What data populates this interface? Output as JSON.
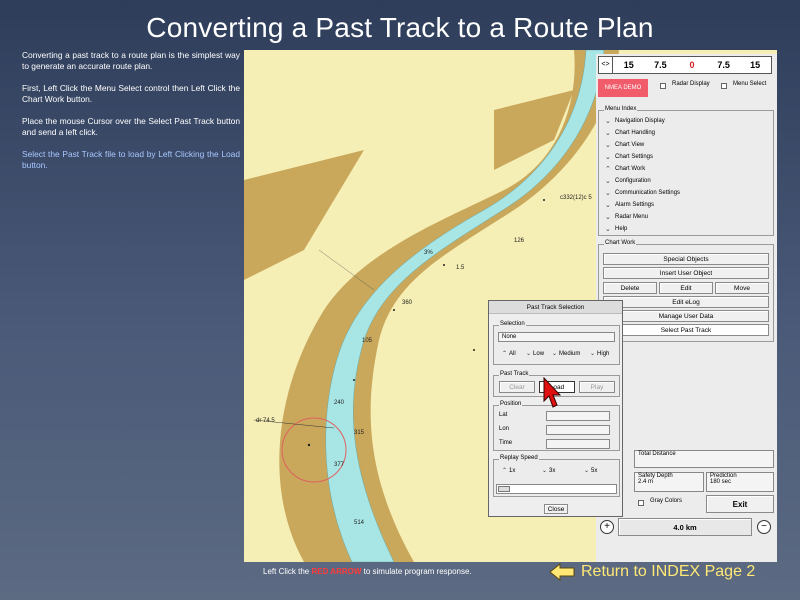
{
  "slide": {
    "title": "Converting a Past Track to a Route Plan",
    "para1": "Converting a past track to a route plan is the simplest way to generate an accurate route plan.",
    "para2": "First, Left Click the Menu Select control then Left Click the Chart Work button.",
    "para3": "Place the mouse Cursor over the Select Past Track button and send a left click.",
    "para4": "Select the Past Track file to load by Left Clicking the Load button.",
    "footer_prefix": "Left Click the ",
    "footer_red": "RED ARROW",
    "footer_suffix": " to simulate program response.",
    "return_link": "Return to INDEX Page 2"
  },
  "chart": {
    "depth_labels": [
      "c332(12)c 5",
      "3%",
      "126",
      "1.5",
      "360",
      "105",
      "240",
      "315",
      "377",
      "514",
      "dr 74.5"
    ]
  },
  "panel": {
    "scale": {
      "arrows": "<>",
      "ticks": [
        "15",
        "7.5",
        "0",
        "7.5",
        "15"
      ]
    },
    "nmea_demo": "NMEA DEMO",
    "radar_display": "Radar Display",
    "menu_select": "Menu Select",
    "menu_index_title": "Menu Index",
    "menu_items": [
      "Navigation Display",
      "Chart Handling",
      "Chart View",
      "Chart Settings",
      "Chart Work",
      "Configuration",
      "Communication Settings",
      "Alarm Settings",
      "Radar Menu",
      "Help"
    ],
    "chart_work_title": "Chart Work",
    "chart_work_buttons": {
      "special_objects": "Special Objects",
      "insert_user_object": "Insert User Object",
      "delete": "Delete",
      "edit": "Edit",
      "move": "Move",
      "edit_elog": "Edit eLog",
      "manage_user_data": "Manage User Data",
      "select_past_track": "Select Past Track"
    },
    "total_distance": "Total Distance",
    "safety_depth_label": "Safety Depth",
    "safety_depth_value": "2.4 m",
    "prediction_label": "Prediction",
    "prediction_value": "180 sec",
    "gray_colors": "Gray Colors",
    "exit": "Exit",
    "zoom_range": "4.0 km"
  },
  "dialog": {
    "title": "Past Track Selection",
    "selection_group": "Selection",
    "selection_value": "None",
    "filters": [
      "All",
      "Low",
      "Medium",
      "High"
    ],
    "past_track_group": "Past Track",
    "clear": "Clear",
    "load": "Load",
    "play": "Play",
    "position_group": "Position",
    "lat": "Lat",
    "lon": "Lon",
    "time": "Time",
    "replay_speed_group": "Replay Speed",
    "speeds": [
      "1x",
      "3x",
      "5x"
    ],
    "close": "Close"
  },
  "colors": {
    "land": "#f6efb5",
    "shallow": "#c9a85c",
    "channel": "#a8e6e6",
    "accent_red": "#ff3b3b",
    "nmea_red": "#f05c6a",
    "link_yellow": "#ffe875"
  }
}
